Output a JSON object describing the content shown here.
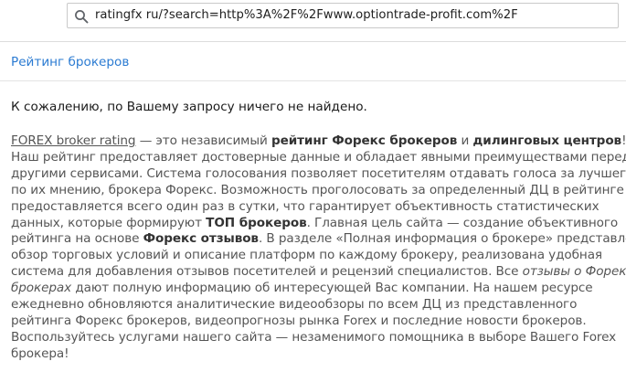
{
  "address_bar": {
    "url": "ratingfx ru/?search=http%3A%2F%2Fwww.optiontrade-profit.com%2F"
  },
  "breadcrumb": {
    "label": "Рейтинг брокеров"
  },
  "search_result": {
    "message": "К сожалению, по Вашему запросу ничего не найдено."
  },
  "article": {
    "l1_link": "FOREX broker rating",
    "l1_a": " — это независимый ",
    "l1_b1": "рейтинг Форекс брокеров",
    "l1_c": " и ",
    "l1_b2": "дилинговых центров",
    "l1_d": "!",
    "l2": "Наш рейтинг предоставляет достоверные данные и обладает явными преимуществами перед",
    "l3": "другими сервисами. Система голосования позволяет посетителям отдавать голоса за лучшего,",
    "l4": "по их мнению, брокера Форекс. Возможность проголосовать за определенный ДЦ в рейтинге",
    "l5": "предоставляется всего один раз в сутки, что гарантирует объективность статистических",
    "l6_a": "данных, которые формируют ",
    "l6_b": "ТОП брокеров",
    "l6_c": ". Главная цель сайта — создание объективного",
    "l7_a": "рейтинга на основе ",
    "l7_b": "Форекс отзывов",
    "l7_c": ". В разделе «Полная информация о брокере» представлен",
    "l8": "обзор торговых условий и описание платформ по каждому брокеру, реализована удобная",
    "l9_a": "система для добавления отзывов посетителей и рецензий специалистов. Все ",
    "l9_i": "отзывы о Форекс",
    "l10_i": "брокерах",
    "l10_a": " дают полную информацию об интересующей Вас компании. На нашем ресурсе",
    "l11": "ежедневно обновляются аналитические видеообзоры по всем ДЦ из представленного",
    "l12": "рейтинга Форекс брокеров, видеопрогнозы рынка Forex и последние новости брокеров.",
    "l13": "Воспользуйтесь услугами нашего сайта — незаменимого помощника в выборе Вашего Forex",
    "l14": "брокера!"
  },
  "colors": {
    "link": "#2b7bd2",
    "body_text": "#555555",
    "bold_text": "#333333"
  },
  "icons": [
    "search-icon"
  ]
}
